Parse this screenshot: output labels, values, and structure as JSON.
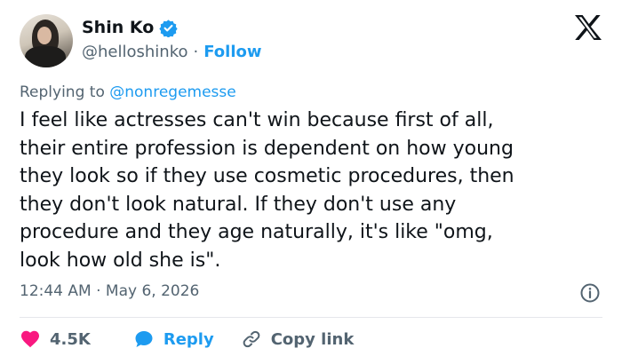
{
  "author": {
    "display_name": "Shin Ko",
    "handle": "@helloshinko",
    "separator": "·",
    "follow_label": "Follow",
    "verified": true
  },
  "reply_context": {
    "prefix": "Replying to",
    "mention": "@nonregemesse"
  },
  "tweet": {
    "text": "I feel like actresses can't win because first of all,\ntheir entire profession is dependent on how young\nthey look so if they use cosmetic procedures, then\nthey don't look natural. If they don't use any\nprocedure and they age naturally, it's like \"omg,\nlook how old she is\".",
    "timestamp": "12:44 AM · May 6, 2026"
  },
  "actions": {
    "like_count": "4.5K",
    "reply_label": "Reply",
    "copy_link_label": "Copy link"
  },
  "colors": {
    "accent": "#1d9bf0",
    "like": "#f91880",
    "text": "#0f1419",
    "muted": "#536471"
  },
  "icons": [
    "verified-badge-icon",
    "x-logo-icon",
    "info-icon",
    "heart-icon",
    "reply-bubble-icon",
    "link-icon"
  ]
}
